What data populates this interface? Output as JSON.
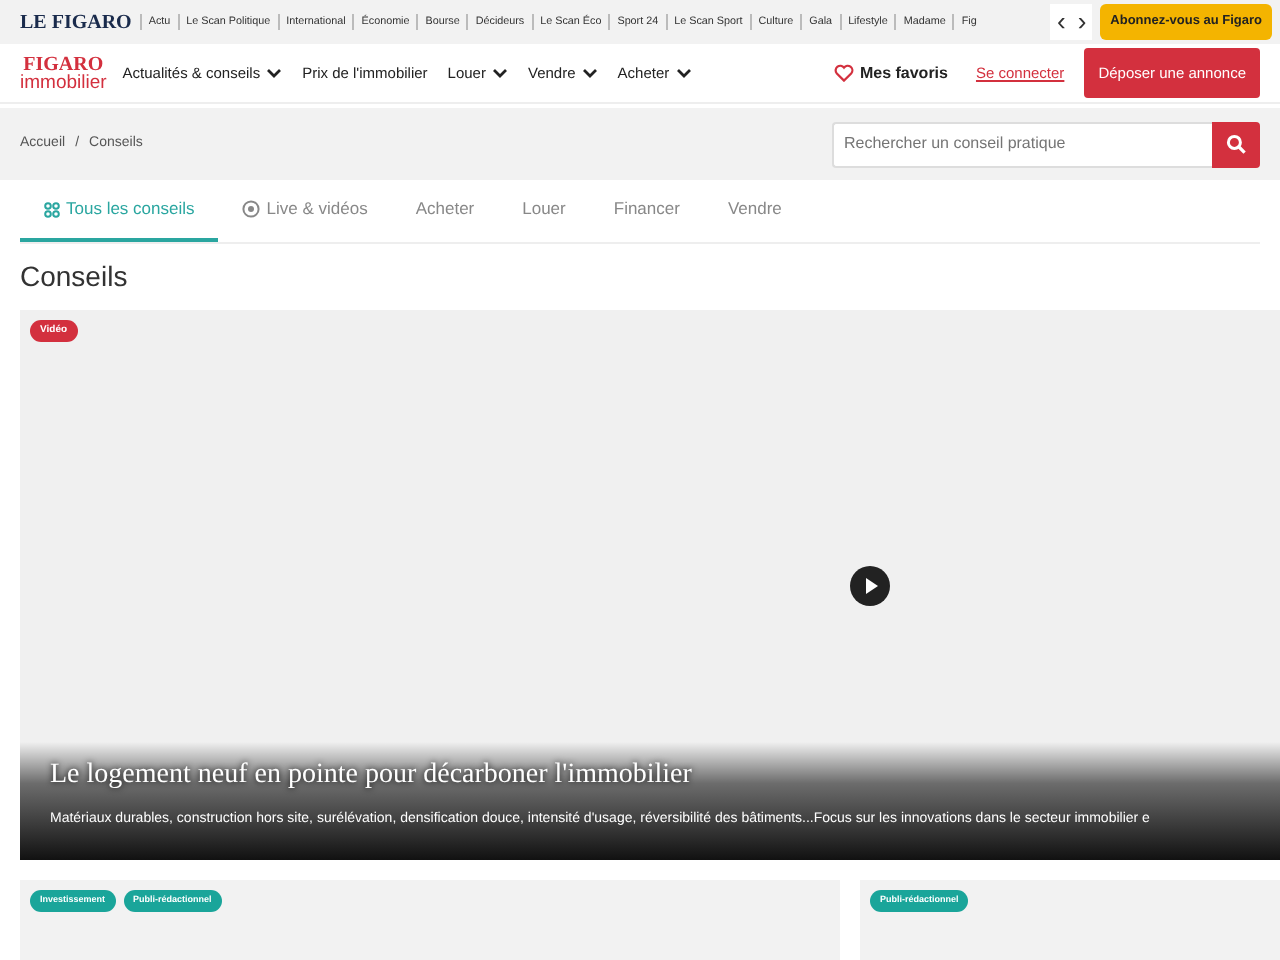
{
  "top_bar": {
    "logo": "LE FIGARO",
    "links": [
      "Actu",
      "Le Scan Politique",
      "International",
      "Économie",
      "Bourse",
      "Décideurs",
      "Le Scan Éco",
      "Sport 24",
      "Le Scan Sport",
      "Culture",
      "Gala",
      "Lifestyle",
      "Madame",
      "Fig"
    ],
    "prev": "‹",
    "next": "›",
    "subscribe": "Abonnez-vous au Figaro"
  },
  "header": {
    "logo_top": "FIGARO",
    "logo_bottom": "immobilier",
    "menu": [
      {
        "label": "Actualités & conseils",
        "dropdown": true
      },
      {
        "label": "Prix de l'immobilier",
        "dropdown": false
      },
      {
        "label": "Louer",
        "dropdown": true
      },
      {
        "label": "Vendre",
        "dropdown": true
      },
      {
        "label": "Acheter",
        "dropdown": true
      }
    ],
    "favorites": "Mes favoris",
    "login": "Se connecter",
    "post": "Déposer une annonce"
  },
  "breadcrumb": {
    "items": [
      "Accueil",
      "Conseils"
    ],
    "separator": "/"
  },
  "search": {
    "placeholder": "Rechercher un conseil pratique"
  },
  "tabs": [
    {
      "label": "Tous les conseils",
      "kind": "grid",
      "selected": true
    },
    {
      "label": "Live & vidéos",
      "kind": "play",
      "selected": false
    },
    {
      "label": "Acheter",
      "selected": false
    },
    {
      "label": "Louer",
      "selected": false
    },
    {
      "label": "Financer",
      "selected": false
    },
    {
      "label": "Vendre",
      "selected": false
    }
  ],
  "heading": "Conseils",
  "featured": {
    "badge": "Vidéo",
    "title": "Le logement neuf en pointe pour décarboner l'immobilier",
    "summary": "Matériaux durables, construction hors site, surélévation, densification douce, intensité d'usage, réversibilité des bâtiments...Focus sur les innovations dans le secteur immobilier e"
  },
  "cards": [
    {
      "tags": [
        "Investissement",
        "Publi-rédactionnel"
      ]
    },
    {
      "tags": [
        "Publi-rédactionnel"
      ]
    }
  ]
}
